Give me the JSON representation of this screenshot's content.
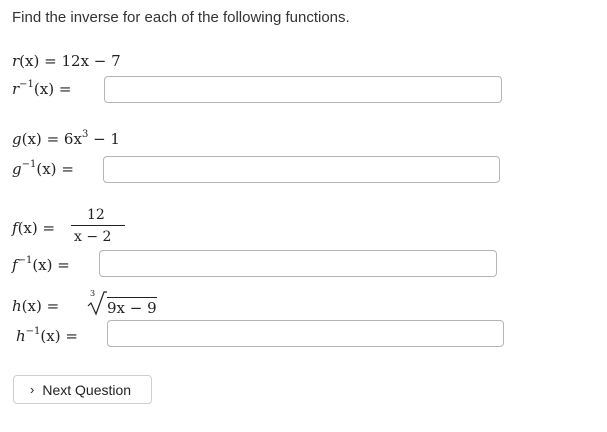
{
  "instructions": "Find the inverse for each of the following functions.",
  "problems": [
    {
      "fn_name": "r",
      "fn_arg": "(x)",
      "eq": "=",
      "rhs": "12x − 7",
      "inv_name": "r",
      "inv_exp": "−1",
      "inv_arg": "(x)",
      "inv_eq": "=",
      "answer": ""
    },
    {
      "fn_name": "g",
      "fn_arg": "(x)",
      "eq": "=",
      "rhs_base": "6x",
      "rhs_exp": "3",
      "rhs_tail": "− 1",
      "inv_name": "g",
      "inv_exp": "−1",
      "inv_arg": "(x)",
      "inv_eq": "=",
      "answer": ""
    },
    {
      "fn_name": "f",
      "fn_arg": "(x)",
      "eq": "=",
      "numerator": "12",
      "denominator": "x − 2",
      "inv_name": "f",
      "inv_exp": "−1",
      "inv_arg": "(x)",
      "inv_eq": "=",
      "answer": ""
    },
    {
      "fn_name": "h",
      "fn_arg": "(x)",
      "eq": "=",
      "root_index": "3",
      "radicand": "9x − 9",
      "inv_name": "h",
      "inv_exp": "−1",
      "inv_arg": "(x)",
      "inv_eq": "=",
      "answer": ""
    }
  ],
  "next_button": {
    "label": "Next Question",
    "icon": "chevron-right-icon"
  }
}
